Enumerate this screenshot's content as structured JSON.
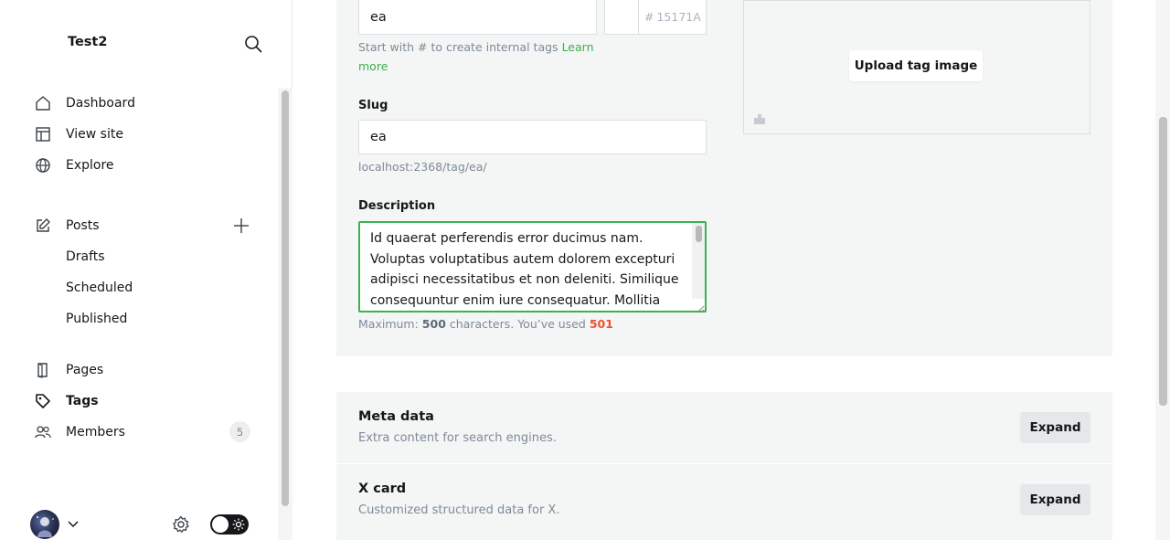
{
  "sidebar": {
    "site_title": "Test2",
    "nav": [
      {
        "label": "Dashboard",
        "icon": "home-icon"
      },
      {
        "label": "View site",
        "icon": "layout-icon"
      },
      {
        "label": "Explore",
        "icon": "globe-icon"
      }
    ],
    "posts": {
      "label": "Posts",
      "icon": "edit-icon",
      "sub": [
        "Drafts",
        "Scheduled",
        "Published"
      ]
    },
    "pages_label": "Pages",
    "tags_label": "Tags",
    "members_label": "Members",
    "members_count": "5"
  },
  "form": {
    "name_value": "ea",
    "color_placeholder": "15171A",
    "color_hash": "#",
    "name_hint": "Start with # to create internal tags",
    "learn_more": "Learn more",
    "slug_label": "Slug",
    "slug_value": "ea",
    "slug_url": "localhost:2368/tag/ea/",
    "description_label": "Description",
    "description_value": "Id quaerat perferendis error ducimus nam. Voluptas voluptatibus autem dolorem excepturi adipisci necessitatibus et non deleniti. Similique consequuntur enim iure consequatur. Mollitia",
    "count_prefix": "Maximum:",
    "count_max": "500",
    "count_mid": "characters. You’ve used",
    "count_used": "501",
    "upload_label": "Upload tag image"
  },
  "sections": [
    {
      "title": "Meta data",
      "desc": "Extra content for search engines.",
      "button": "Expand"
    },
    {
      "title": "X card",
      "desc": "Customized structured data for X.",
      "button": "Expand"
    }
  ],
  "colors": {
    "accent": "#3eb04f",
    "error": "#f05230",
    "card_bg": "#f4f5f5"
  }
}
